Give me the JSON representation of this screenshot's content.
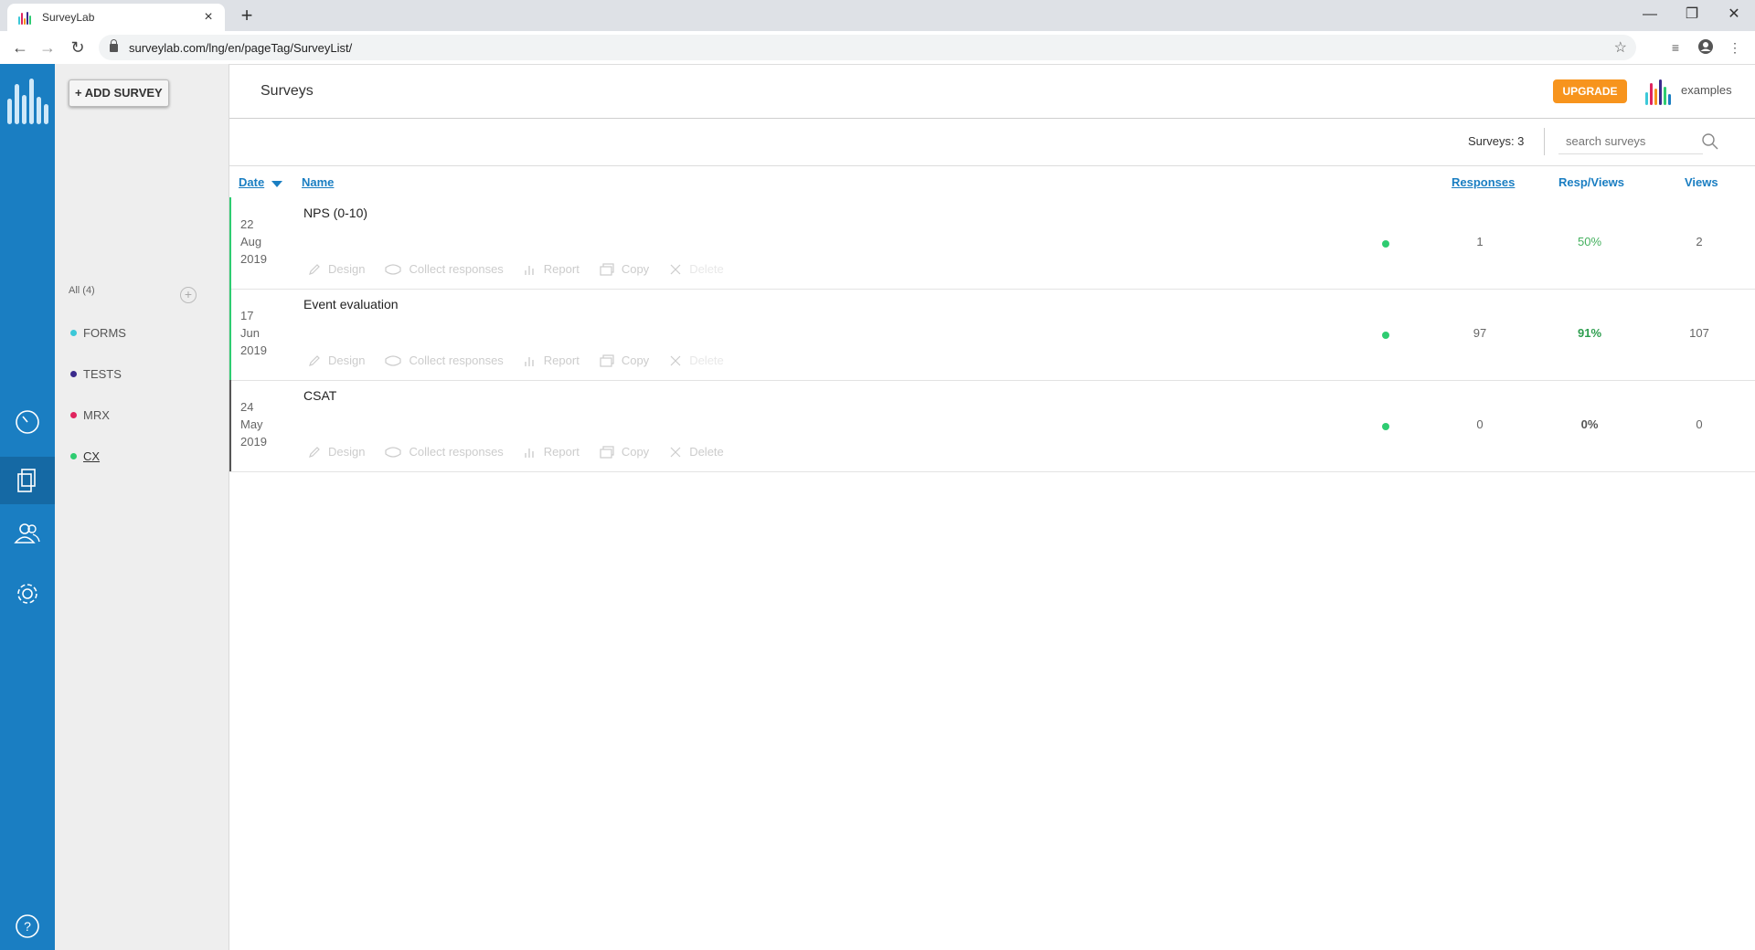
{
  "browser": {
    "tab_title": "SurveyLab",
    "url": "surveylab.com/lng/en/pageTag/SurveyList/",
    "newtab": "+",
    "close": "×"
  },
  "sidebar": {
    "add_survey": "+ ADD SURVEY",
    "tags_all": "All (4)",
    "tags": [
      {
        "label": "FORMS",
        "color": "#3cc8d8"
      },
      {
        "label": "TESTS",
        "color": "#3a2a8c"
      },
      {
        "label": "MRX",
        "color": "#e0245e"
      },
      {
        "label": "CX",
        "color": "#2ecc71"
      }
    ]
  },
  "header": {
    "title": "Surveys",
    "upgrade": "UPGRADE",
    "account": "examples"
  },
  "toolbar": {
    "count": "Surveys: 3",
    "search_placeholder": "search surveys"
  },
  "table": {
    "columns": {
      "date": "Date",
      "name": "Name",
      "responses": "Responses",
      "resp_views": "Resp/Views",
      "views": "Views"
    },
    "actions": [
      "Design",
      "Collect responses",
      "Report",
      "Copy",
      "Delete"
    ],
    "rows": [
      {
        "day": "22",
        "month": "Aug",
        "year": "2019",
        "name": "NPS (0-10)",
        "responses": "1",
        "resp_views": "50%",
        "views": "2",
        "accent": "#2ecc71"
      },
      {
        "day": "17",
        "month": "Jun",
        "year": "2019",
        "name": "Event evaluation",
        "responses": "97",
        "resp_views": "91%",
        "views": "107",
        "accent": "#2ecc71"
      },
      {
        "day": "24",
        "month": "May",
        "year": "2019",
        "name": "CSAT",
        "responses": "0",
        "resp_views": "0%",
        "views": "0",
        "accent": "#555555"
      }
    ]
  },
  "colors": {
    "rail": "#1a7ec2",
    "accent": "#1a7ec2",
    "upgrade": "#f7941d",
    "status": "#2ecc71"
  }
}
